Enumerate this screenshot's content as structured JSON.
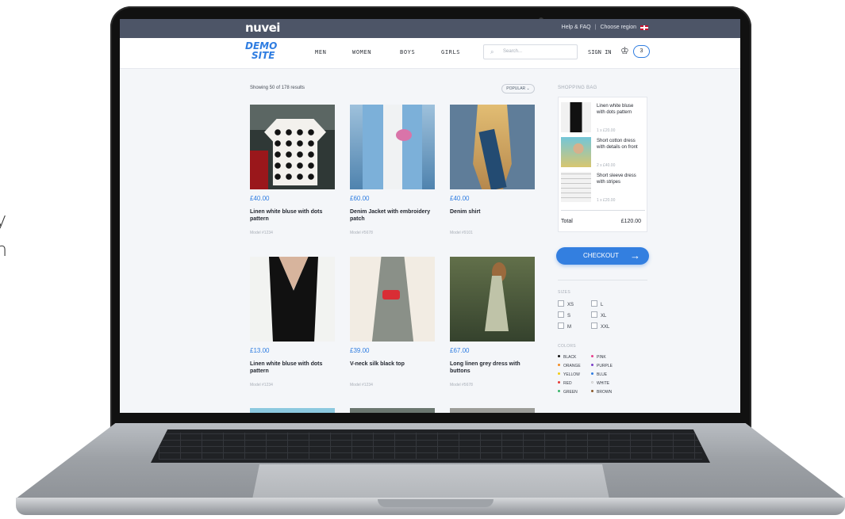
{
  "side_text": [
    "y",
    "n"
  ],
  "browser": {
    "brand": "nuvei",
    "help": "Help & FAQ",
    "region": "Choose region",
    "demo_line1": "DEMO",
    "demo_line2": "SITE"
  },
  "nav": {
    "items": [
      "MEN",
      "WOMEN",
      "BOYS",
      "GIRLS"
    ],
    "search_placeholder": "Search...",
    "sign_in": "SIGN IN",
    "bag_count": "3"
  },
  "listing": {
    "results": "Showing 50 of 178 results",
    "sort": "POPULAR ⌄",
    "products": [
      {
        "price": "£40.00",
        "name": "Linen white bluse with dots pattern",
        "model": "Model #1234"
      },
      {
        "price": "£60.00",
        "name": "Denim Jacket with embroidery patch",
        "model": "Model #5678"
      },
      {
        "price": "£40.00",
        "name": "Denim shirt",
        "model": "Model #9101"
      },
      {
        "price": "£13.00",
        "name": "Linen white bluse with dots pattern",
        "model": "Model #1234"
      },
      {
        "price": "£39.00",
        "name": "V-neck silk black top",
        "model": "Model #1234"
      },
      {
        "price": "£67.00",
        "name": "Long linen grey dress with buttons",
        "model": "Model #5678"
      }
    ]
  },
  "shopping_bag": {
    "title": "SHOPPING BAG",
    "items": [
      {
        "name": "Linen white bluse with dots pattern",
        "price": "1 x £20.00"
      },
      {
        "name": "Short cotton dress with details on front",
        "price": "2 x £40.00"
      },
      {
        "name": "Short sleeve dress with stripes",
        "price": "1 x £20.00"
      }
    ],
    "total_label": "Total",
    "total_value": "£120.00",
    "checkout": "CHECKOUT"
  },
  "filters": {
    "sizes_title": "SIZES",
    "sizes": [
      "XS",
      "L",
      "S",
      "XL",
      "M",
      "XXL"
    ],
    "colors_title": "COLORS",
    "colors": [
      {
        "name": "BLACK",
        "color": "#111111"
      },
      {
        "name": "PINK",
        "color": "#e83e8c"
      },
      {
        "name": "ORANGE",
        "color": "#f28b22"
      },
      {
        "name": "PURPLE",
        "color": "#7b3fc8"
      },
      {
        "name": "YELLOW",
        "color": "#f2cc12"
      },
      {
        "name": "BLUE",
        "color": "#2f7de1"
      },
      {
        "name": "RED",
        "color": "#e53935"
      },
      {
        "name": "WHITE",
        "color": "#ffffff"
      },
      {
        "name": "GREEN",
        "color": "#38b56a"
      },
      {
        "name": "BROWN",
        "color": "#8b5a2b"
      }
    ]
  }
}
